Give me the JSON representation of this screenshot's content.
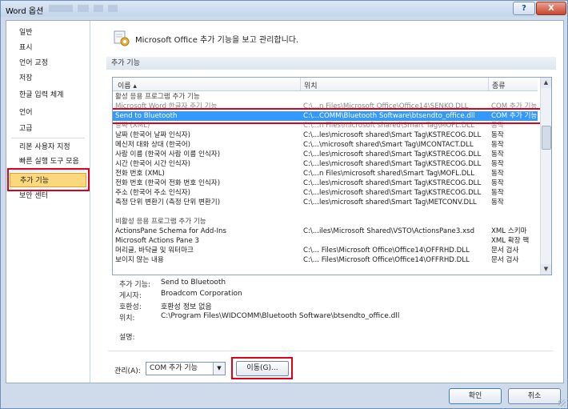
{
  "window": {
    "title": "Word 옵션",
    "help_label": "?",
    "close_label": "X"
  },
  "sidebar": {
    "items": [
      {
        "label": "일반"
      },
      {
        "label": "표시"
      },
      {
        "label": "언어 교정"
      },
      {
        "label": "저장"
      },
      {
        "label": "한글 입력 체계"
      },
      {
        "label": "언어"
      },
      {
        "label": "고급"
      },
      {
        "label": "리본 사용자 지정"
      },
      {
        "label": "빠른 실행 도구 모음"
      },
      {
        "label": "추가 기능"
      },
      {
        "label": "보안 센터"
      }
    ],
    "active_index": 9
  },
  "main": {
    "title": "Microsoft Office 추가 기능을 보고 관리합니다.",
    "section_title": "추가 기능"
  },
  "table": {
    "headers": [
      "이름 ▴",
      "위치",
      "종류"
    ],
    "rows": [
      {
        "name": "활성 응용 프로그램 추가 기능",
        "location": "",
        "type": "",
        "group": true
      },
      {
        "name": "Microsoft Word 한글자 주기 기능",
        "location": "C:\\...n Files\\Microsoft Office\\Office14\\SENKO.DLL",
        "type": "COM 추가 기능",
        "struck": true
      },
      {
        "name": "Send to Bluetooth",
        "location": "C:\\...COMM\\Bluetooth Software\\btsendto_office.dll",
        "type": "COM 추가 기능",
        "selected": true
      },
      {
        "name": "날짜 (XML)",
        "location": "C:\\...n Files\\microsoft shared\\Smart Tag\\MOFL.DLL",
        "type": "동작",
        "struck": true
      },
      {
        "name": "날짜 (한국어 날짜 인식자)",
        "location": "C:\\...les\\microsoft shared\\Smart Tag\\KSTRECOG.DLL",
        "type": "동작"
      },
      {
        "name": "메신저 대화 상대 (한국어)",
        "location": "C:\\...\\microsoft shared\\Smart Tag\\IMCONTACT.DLL",
        "type": "동작"
      },
      {
        "name": "사람 이름 (한국어 사람 이름 인식자)",
        "location": "C:\\...les\\microsoft shared\\Smart Tag\\KSTRECOG.DLL",
        "type": "동작"
      },
      {
        "name": "시간 (한국어 시간 인식자)",
        "location": "C:\\...les\\microsoft shared\\Smart Tag\\KSTRECOG.DLL",
        "type": "동작"
      },
      {
        "name": "전화 번호 (XML)",
        "location": "C:\\...n Files\\microsoft shared\\Smart Tag\\MOFL.DLL",
        "type": "동작"
      },
      {
        "name": "전화 번호 (한국어 전화 번호 인식자)",
        "location": "C:\\...les\\microsoft shared\\Smart Tag\\KSTRECOG.DLL",
        "type": "동작"
      },
      {
        "name": "주소 (한국어 주소 인식자)",
        "location": "C:\\...les\\microsoft shared\\Smart Tag\\KSTRECOG.DLL",
        "type": "동작"
      },
      {
        "name": "측정 단위 변환기 (측정 단위 변환기)",
        "location": "C:\\...les\\microsoft shared\\Smart Tag\\METCONV.DLL",
        "type": "동작"
      },
      {
        "name": "",
        "location": "",
        "type": "",
        "spacer": true
      },
      {
        "name": "비활성 응용 프로그램 추가 기능",
        "location": "",
        "type": "",
        "group": true
      },
      {
        "name": "ActionsPane Schema for Add-Ins",
        "location": "C:\\...iles\\Microsoft Shared\\VSTO\\ActionsPane3.xsd",
        "type": "XML 스키마"
      },
      {
        "name": "Microsoft Actions Pane 3",
        "location": "",
        "type": "XML 확장 팩"
      },
      {
        "name": "머리글, 바닥글 및 워터마크",
        "location": "C:\\... Files\\Microsoft Office\\Office14\\OFFRHD.DLL",
        "type": "문서 검사"
      },
      {
        "name": "보이지 않는 내용",
        "location": "C:\\... Files\\Microsoft Office\\Office14\\OFFRHD.DLL",
        "type": "문서 검사"
      }
    ]
  },
  "details": [
    {
      "label": "추가 기능:",
      "value": "Send to Bluetooth"
    },
    {
      "label": "게시자:",
      "value": "Broadcom Corporation"
    },
    {
      "label": "호환성:",
      "value": "호환성 정보 없음"
    },
    {
      "label": "위치:",
      "value": "C:\\Program Files\\WIDCOMM\\Bluetooth Software\\btsendto_office.dll"
    },
    {
      "label": "",
      "value": ""
    },
    {
      "label": "설명:",
      "value": ""
    }
  ],
  "manage": {
    "label": "관리(A):",
    "selected": "COM 추가 기능",
    "go_label": "이동(G)..."
  },
  "footer": {
    "ok_label": "확인",
    "cancel_label": "취소"
  },
  "colors": {
    "selection": "#3399ff",
    "highlight_box": "#e0001b",
    "active_nav": "#fbd77e"
  }
}
